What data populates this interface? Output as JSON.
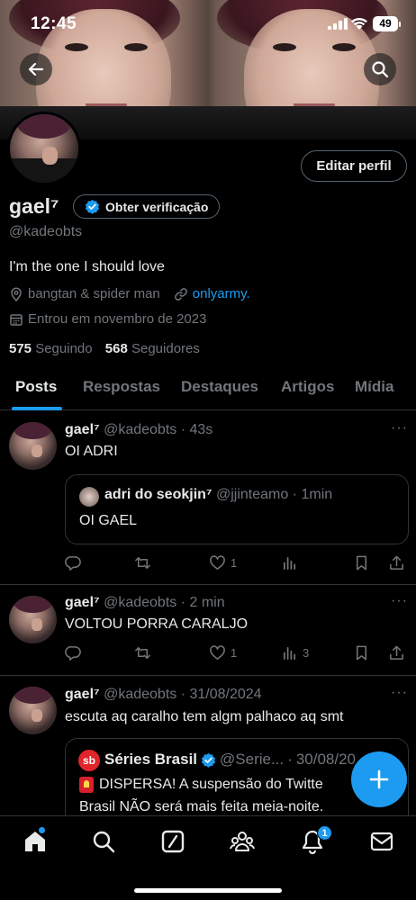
{
  "status_bar": {
    "time": "12:45",
    "battery": "49"
  },
  "profile": {
    "edit_button": "Editar perfil",
    "name": "gael⁷",
    "verify_button": "Obter verificação",
    "handle": "@kadeobts",
    "bio": "I'm the one I should love",
    "location": "bangtan & spider man",
    "link": "onlyarmy.",
    "joined": "Entrou em novembro de 2023",
    "following_count": "575",
    "following_label": "Seguindo",
    "followers_count": "568",
    "followers_label": "Seguidores"
  },
  "tabs": [
    "Posts",
    "Respostas",
    "Destaques",
    "Artigos",
    "Mídia"
  ],
  "posts": [
    {
      "name": "gael⁷",
      "handle": "@kadeobts",
      "time": "43s",
      "text": "OI ADRI",
      "quote": {
        "name": "adri do seokjin⁷",
        "handle": "@jjinteamo",
        "time": "1min",
        "text": "OI GAEL"
      },
      "likes": "1",
      "views": ""
    },
    {
      "name": "gael⁷",
      "handle": "@kadeobts",
      "time": "2 min",
      "text": "VOLTOU PORRA CARALJO",
      "likes": "1",
      "views": "3"
    },
    {
      "name": "gael⁷",
      "handle": "@kadeobts",
      "time": "31/08/2024",
      "text": "escuta aq caralho tem algm palhaco aq smt",
      "quote": {
        "logo": "sb",
        "name": "Séries Brasil",
        "handle": "@Serie...",
        "time": "30/08/20",
        "line1": "DISPERSA! A suspensão do Twitte",
        "line2": "Brasil NÃO será mais feita meia-noite."
      }
    }
  ],
  "notifications_badge": "1",
  "colors": {
    "accent": "#1d9bf0",
    "border": "#2f3336",
    "muted": "#71767b"
  }
}
